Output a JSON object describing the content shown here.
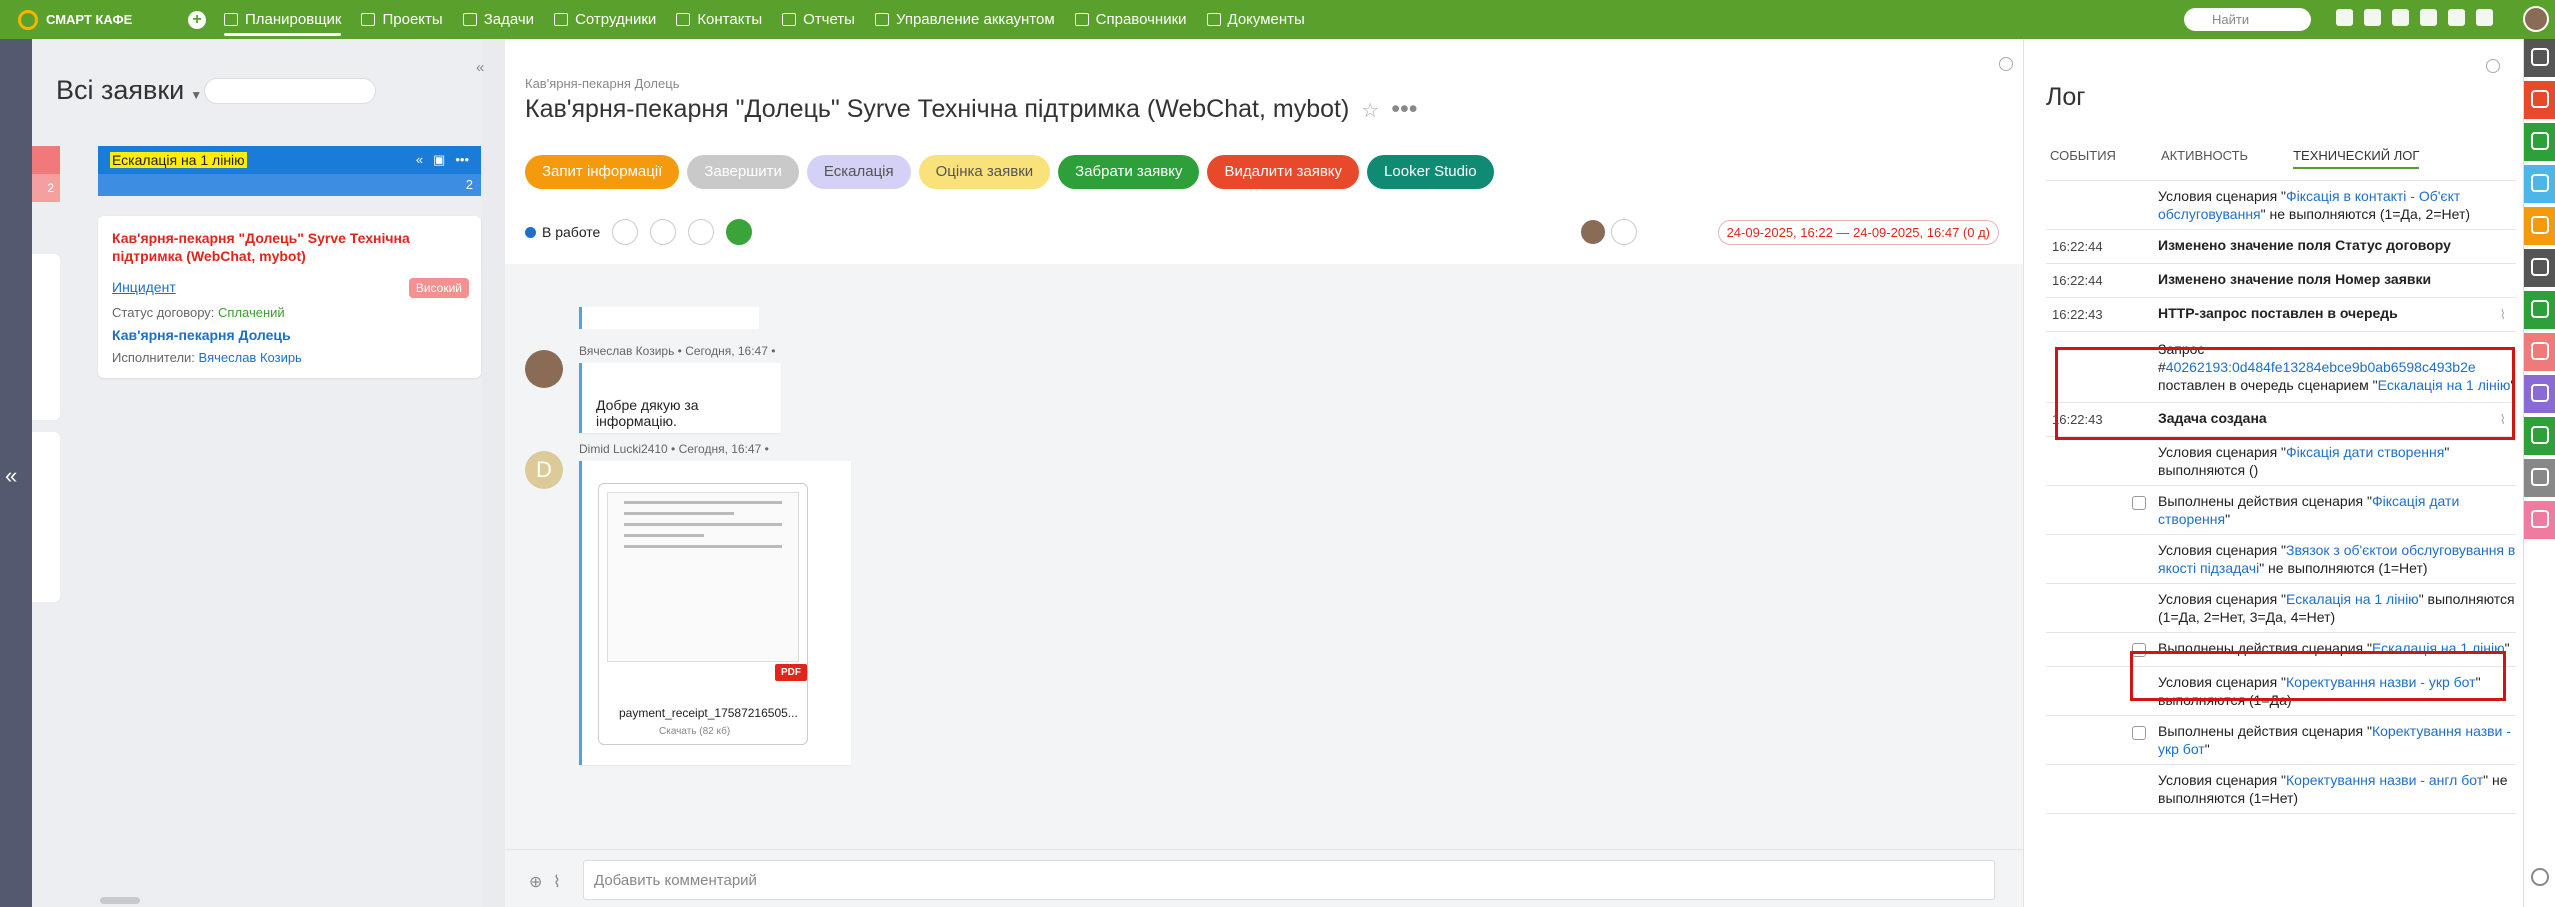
{
  "topbar": {
    "brand": "СМАРТ КАФЕ",
    "search_placeholder": "Найти",
    "nav": [
      "Планировщик",
      "Проекты",
      "Задачи",
      "Сотрудники",
      "Контакты",
      "Отчеты",
      "Управление аккаунтом",
      "Справочники",
      "Документы"
    ]
  },
  "list": {
    "title": "Всі заявки",
    "column": {
      "name": "Ескалація на 1 лінію",
      "count": "2"
    },
    "stub_counts": [
      "2"
    ],
    "card": {
      "title": "Кав'ярня-пекарня \"Долець\" Syrve Технічна підтримка (WebChat, mybot)",
      "type": "Инцидент",
      "priority": "Високий",
      "status_label": "Статус договору:",
      "status_value": "Сплачений",
      "org": "Кав'ярня-пекарня Долець",
      "exec_label": "Исполнители:",
      "exec_value": "Вячеслав Козирь"
    }
  },
  "task": {
    "breadcrumb": "Кав'ярня-пекарня Долець",
    "title": "Кав'ярня-пекарня \"Долець\" Syrve Технічна підтримка (WebChat, mybot)",
    "buttons": [
      {
        "label": "Запит інформації",
        "color": "#f59a0c",
        "text": "#fff"
      },
      {
        "label": "Завершити",
        "color": "#c9c9c9",
        "text": "#fff"
      },
      {
        "label": "Ескалація",
        "color": "#d3d1f5",
        "text": "#555"
      },
      {
        "label": "Оцінка заявки",
        "color": "#f9e27a",
        "text": "#555"
      },
      {
        "label": "Забрати заявку",
        "color": "#2ea03a",
        "text": "#fff"
      },
      {
        "label": "Видалити заявку",
        "color": "#e8492a",
        "text": "#fff"
      },
      {
        "label": "Looker Studio",
        "color": "#0f8a73",
        "text": "#fff"
      }
    ],
    "status": "В работе",
    "daterange": "24-09-2025, 16:22 — 24-09-2025, 16:47  (0 д)"
  },
  "feed": {
    "msg1": {
      "header": "Вячеслав Козирь • Сегодня, 16:47 •",
      "text": "Добре дякую за інформацію."
    },
    "msg2": {
      "header": "Dimid Lucki2410 • Сегодня, 16:47 •",
      "avatar_letter": "D",
      "file_name": "payment_receipt_17587216505...",
      "file_badge": "PDF",
      "download": "Скачать  (82 кб)"
    },
    "comment_placeholder": "Добавить комментарий"
  },
  "log": {
    "title": "Лог",
    "tabs": [
      "СОБЫТИЯ",
      "АКТИВНОСТЬ",
      "ТЕХНИЧЕСКИЙ ЛОГ"
    ],
    "r1": {
      "pre": "Условия сценария \"",
      "link": "Фіксація в контакті - Об'єкт обслуговування",
      "post": "\" не выполняются (1=Да, 2=Нет)"
    },
    "r2": {
      "time": "16:22:44",
      "text": "Изменено значение поля Статус договору"
    },
    "r3": {
      "time": "16:22:44",
      "text": "Изменено значение поля Номер заявки"
    },
    "r4": {
      "time": "16:22:43",
      "text": "HTTP-запрос поставлен в очередь"
    },
    "r5": {
      "pre": "Запрос #",
      "link": "40262193:0d484fe13284ebce9b0ab6598c493b2e",
      "mid": " поставлен в очередь сценарием \"",
      "link2": "Ескалація на 1 лінію",
      "post": "\""
    },
    "r6": {
      "time": "16:22:43",
      "text": "Задача создана"
    },
    "r7": {
      "pre": "Условия сценария \"",
      "link": "Фіксація дати створення",
      "post": "\" выполняются ()"
    },
    "r8": {
      "pre": "Выполнены действия сценария \"",
      "link": "Фіксація дати створення",
      "post": "\""
    },
    "r9": {
      "pre": "Условия сценария \"",
      "link": "Звязок з об'єктои обслуговування в якості підзадачі",
      "post": "\" не выполняются (1=Нет)"
    },
    "r10": {
      "pre": "Условия сценария \"",
      "link": "Ескалація на 1 лінію",
      "post": "\" выполняются (1=Да, 2=Нет, 3=Да, 4=Нет)"
    },
    "r11": {
      "pre": "Выполнены действия сценария \"",
      "link": "Ескалація на 1 лінію",
      "post": "\""
    },
    "r12": {
      "pre": "Условия сценария \"",
      "link": "Коректування назви - укр бот",
      "post": "\" выполняются (1=Да)"
    },
    "r13": {
      "pre": "Выполнены действия сценария \"",
      "link": "Коректування назви - укр бот",
      "post": "\""
    },
    "r14": {
      "pre": "Условия сценария \"",
      "link": "Коректування назви - англ бот",
      "post": "\" не выполняются (1=Нет)"
    }
  },
  "rail_colors": [
    "#555",
    "#e8492a",
    "#2ea03a",
    "#4db6e8",
    "#f59a0c",
    "#555",
    "#2ea03a",
    "#f07a7a",
    "#8a6bd6",
    "#2ea03a",
    "#888",
    "#f07aa0"
  ]
}
